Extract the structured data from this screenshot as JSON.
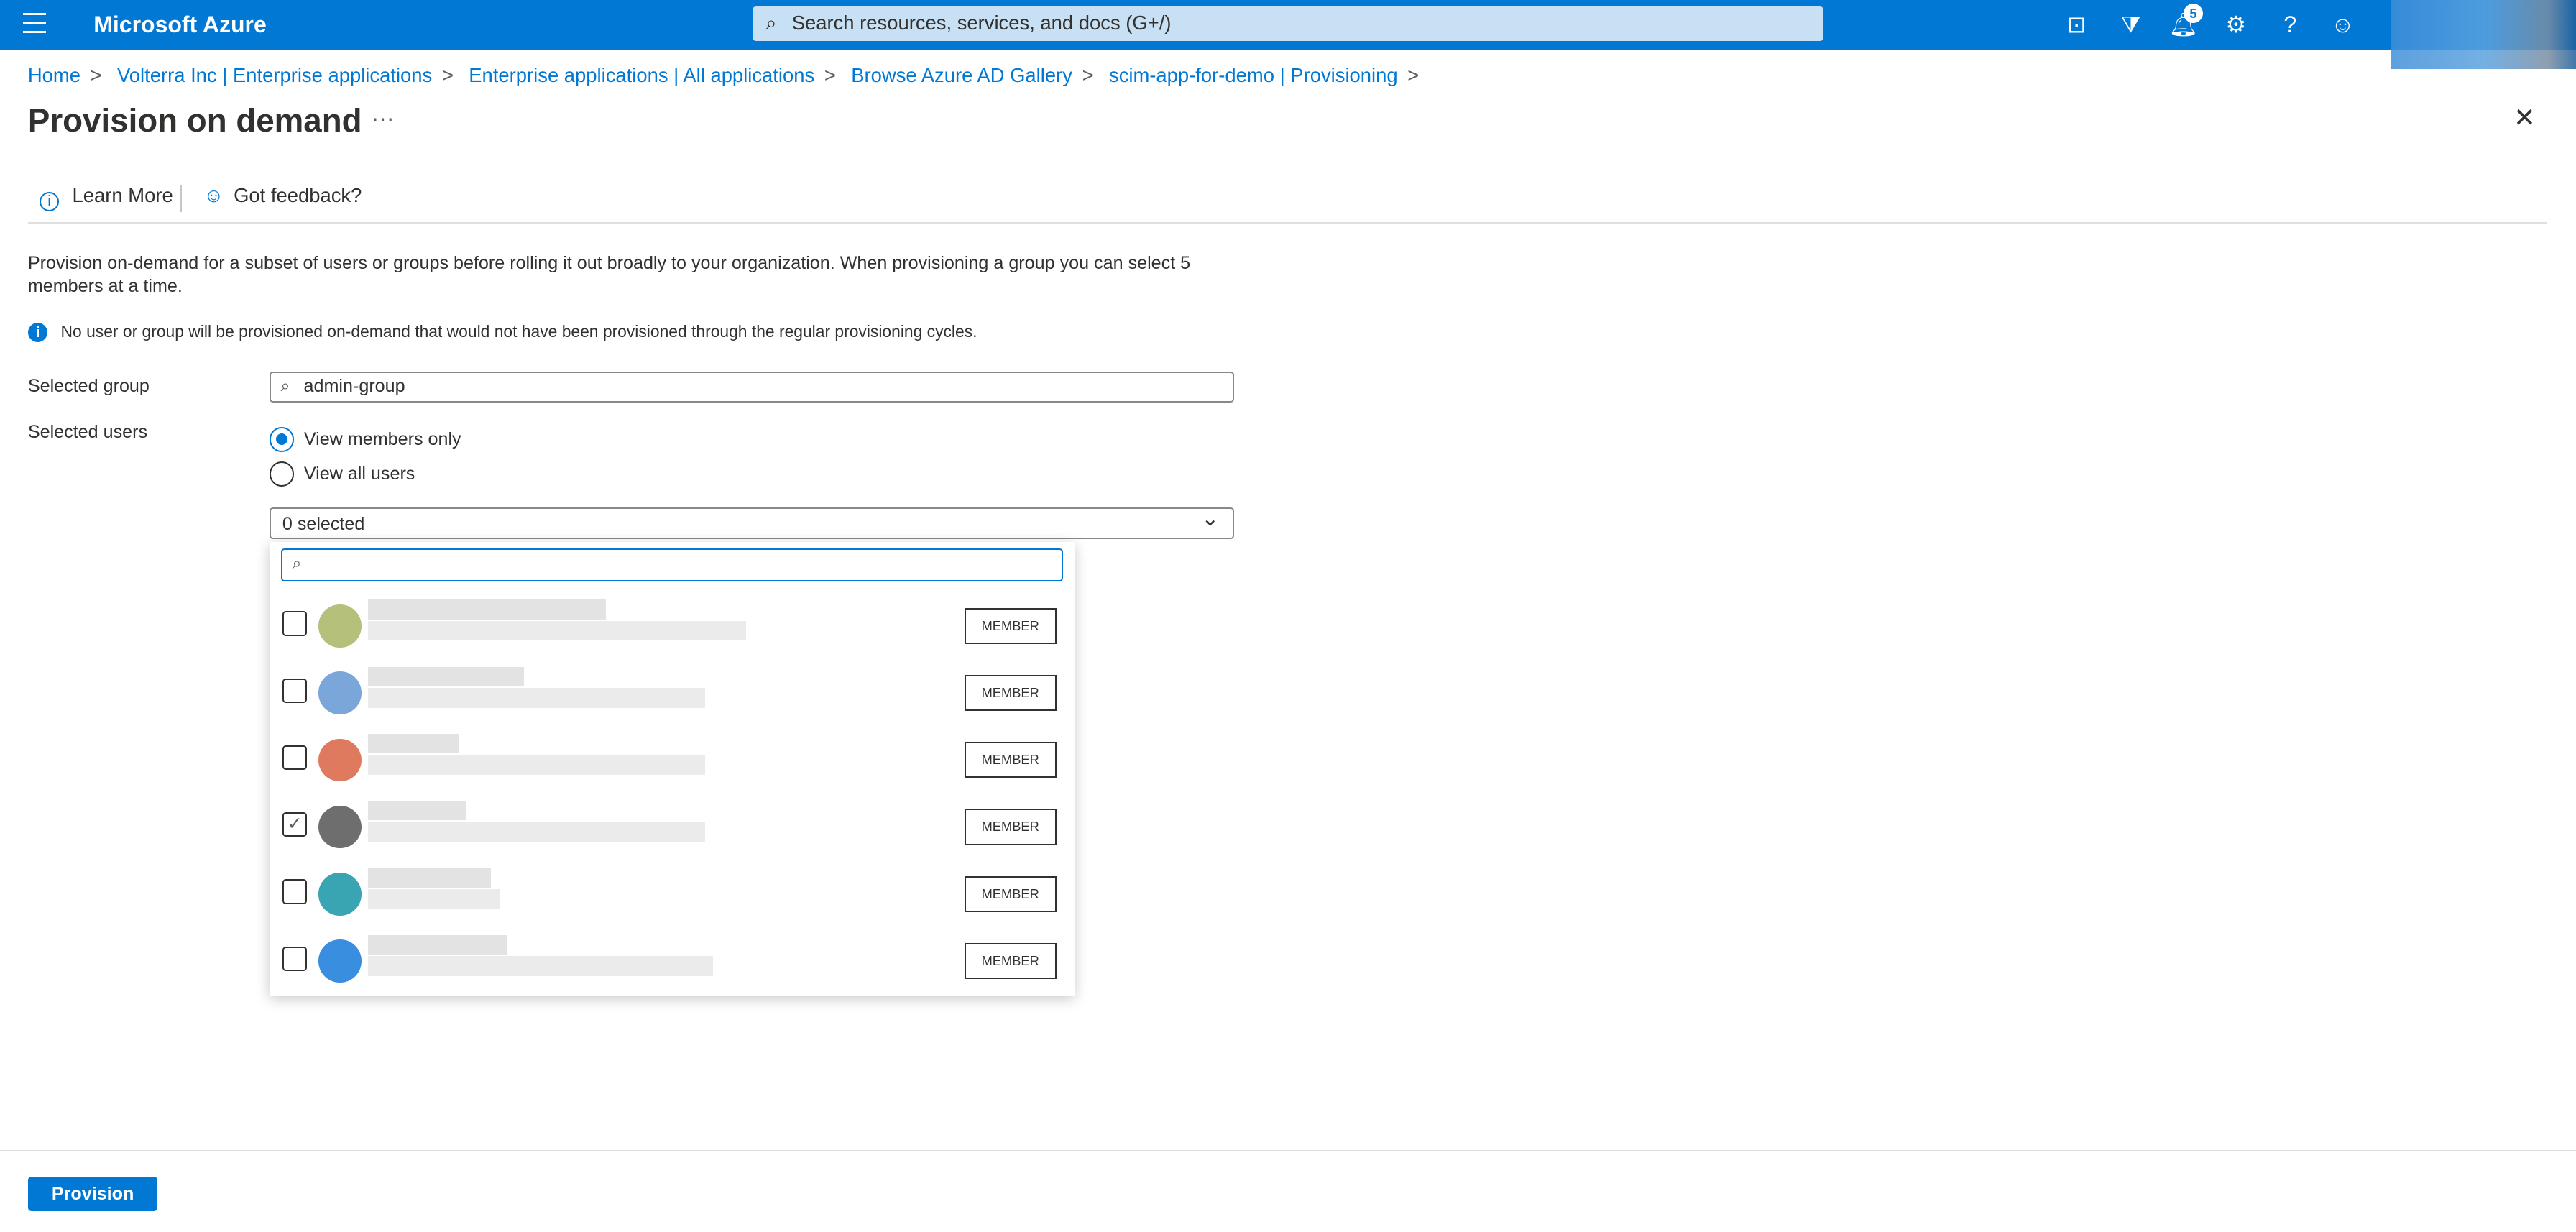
{
  "topbar": {
    "brand": "Microsoft Azure",
    "search_placeholder": "Search resources, services, and docs (G+/)",
    "notification_count": "5",
    "icons": [
      "cloud-shell-icon",
      "directory-filter-icon",
      "bell-icon",
      "gear-icon",
      "help-icon",
      "feedback-icon"
    ],
    "accent": "#0078d4"
  },
  "breadcrumb": [
    "Home",
    "Volterra Inc | Enterprise applications",
    "Enterprise applications | All applications",
    "Browse Azure AD Gallery",
    "scim-app-for-demo | Provisioning"
  ],
  "page": {
    "title": "Provision on demand",
    "more": "···"
  },
  "toolbar": {
    "learn_more": "Learn More",
    "feedback": "Got feedback?"
  },
  "description": "Provision on-demand for a subset of users or groups before rolling it out broadly to your organization. When provisioning a group you can select 5 members at a time.",
  "info": "No user or group will be provisioned on-demand that would not have been provisioned through the regular provisioning cycles.",
  "form": {
    "group_label": "Selected group",
    "group_value": "admin-group",
    "users_label": "Selected users",
    "radio_members": "View members only",
    "radio_all": "View all users",
    "dropdown_value": "0 selected"
  },
  "members": [
    {
      "checked": false,
      "avatar": "#b5c07a",
      "badge": "MEMBER"
    },
    {
      "checked": false,
      "avatar": "#7aa6d9",
      "badge": "MEMBER"
    },
    {
      "checked": false,
      "avatar": "#e07a5f",
      "badge": "MEMBER"
    },
    {
      "checked": true,
      "avatar": "#6e6e6e",
      "badge": "MEMBER"
    },
    {
      "checked": false,
      "avatar": "#3aa5b2",
      "badge": "MEMBER"
    },
    {
      "checked": false,
      "avatar": "#3a8ee0",
      "badge": "MEMBER"
    }
  ],
  "footer": {
    "provision": "Provision"
  }
}
